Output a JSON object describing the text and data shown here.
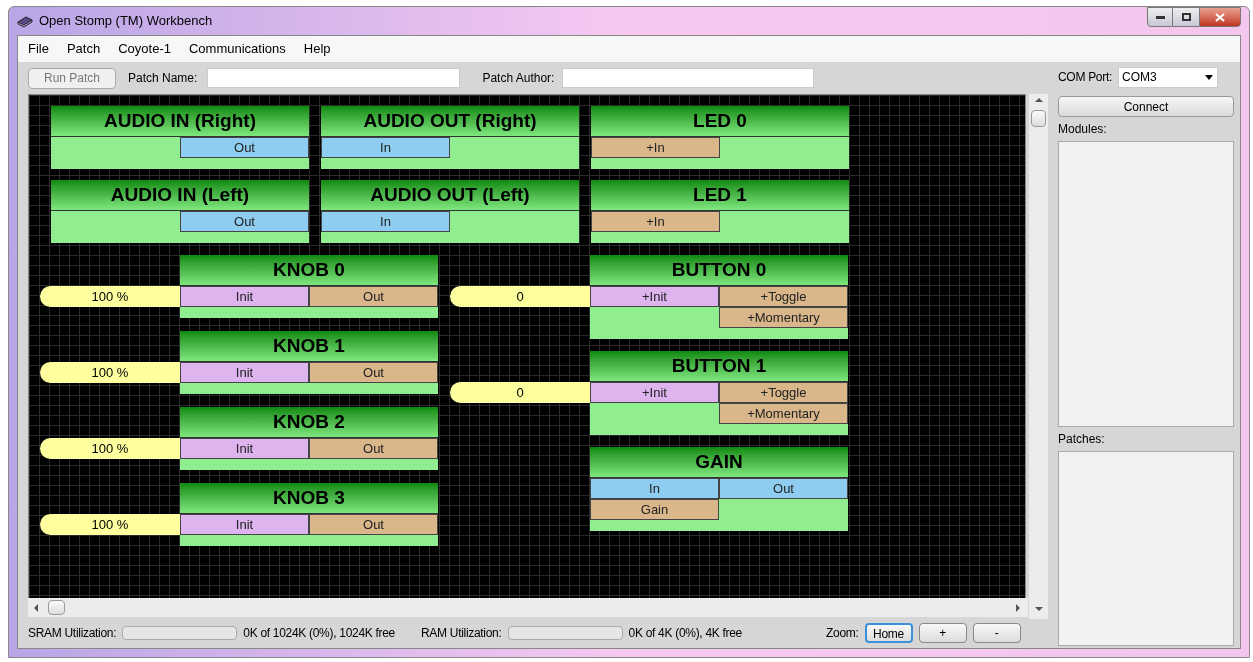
{
  "window": {
    "title": "Open Stomp (TM) Workbench"
  },
  "menu": [
    "File",
    "Patch",
    "Coyote-1",
    "Communications",
    "Help"
  ],
  "toolbar": {
    "run_button": {
      "label": "Run Patch",
      "disabled": true
    },
    "patch_name": {
      "label": "Patch Name:"
    },
    "patch_author": {
      "label": "Patch Author:"
    }
  },
  "canvas": {
    "top_columns": [
      [
        {
          "title": "AUDIO IN (Right)",
          "rows": [
            [
              "",
              {
                "label": "Out",
                "kind": "audio"
              }
            ]
          ]
        },
        {
          "title": "AUDIO IN (Left)",
          "rows": [
            [
              "",
              {
                "label": "Out",
                "kind": "audio"
              }
            ]
          ]
        }
      ],
      [
        {
          "title": "AUDIO OUT (Right)",
          "rows": [
            [
              {
                "label": "In",
                "kind": "audio"
              },
              ""
            ]
          ]
        },
        {
          "title": "AUDIO OUT (Left)",
          "rows": [
            [
              {
                "label": "In",
                "kind": "audio"
              },
              ""
            ]
          ]
        }
      ],
      [
        {
          "title": "LED 0",
          "rows": [
            [
              {
                "label": "+In",
                "kind": "control"
              },
              ""
            ]
          ]
        },
        {
          "title": "LED 1",
          "rows": [
            [
              {
                "label": "+In",
                "kind": "control"
              },
              ""
            ]
          ]
        }
      ]
    ],
    "left_modules": [
      {
        "title": "KNOB 0",
        "value": "100 %",
        "rows": [
          [
            {
              "label": "Init",
              "kind": "init"
            },
            {
              "label": "Out",
              "kind": "control"
            }
          ]
        ]
      },
      {
        "title": "KNOB 1",
        "value": "100 %",
        "rows": [
          [
            {
              "label": "Init",
              "kind": "init"
            },
            {
              "label": "Out",
              "kind": "control"
            }
          ]
        ]
      },
      {
        "title": "KNOB 2",
        "value": "100 %",
        "rows": [
          [
            {
              "label": "Init",
              "kind": "init"
            },
            {
              "label": "Out",
              "kind": "control"
            }
          ]
        ]
      },
      {
        "title": "KNOB 3",
        "value": "100 %",
        "rows": [
          [
            {
              "label": "Init",
              "kind": "init"
            },
            {
              "label": "Out",
              "kind": "control"
            }
          ]
        ]
      }
    ],
    "right_modules": [
      {
        "title": "BUTTON 0",
        "value": "0",
        "rows": [
          [
            {
              "label": "+Init",
              "kind": "init"
            },
            {
              "label": "+Toggle",
              "kind": "control"
            }
          ],
          [
            "",
            {
              "label": "+Momentary",
              "kind": "control"
            }
          ]
        ]
      },
      {
        "title": "BUTTON 1",
        "value": "0",
        "rows": [
          [
            {
              "label": "+Init",
              "kind": "init"
            },
            {
              "label": "+Toggle",
              "kind": "control"
            }
          ],
          [
            "",
            {
              "label": "+Momentary",
              "kind": "control"
            }
          ]
        ]
      },
      {
        "title": "GAIN",
        "rows": [
          [
            {
              "label": "In",
              "kind": "audio"
            },
            {
              "label": "Out",
              "kind": "audio"
            }
          ],
          [
            {
              "label": "Gain",
              "kind": "control"
            },
            ""
          ]
        ]
      }
    ]
  },
  "status_bar": {
    "meters": [
      {
        "label": "SRAM Utilization:",
        "reading": "0K of 1024K (0%), 1024K free"
      },
      {
        "label": "RAM Utilization:",
        "reading": "0K of 4K (0%), 4K free"
      }
    ],
    "zoom": {
      "label": "Zoom:",
      "buttons": [
        {
          "label": "Home",
          "selected": true
        },
        {
          "label": "+",
          "selected": false
        },
        {
          "label": "-",
          "selected": false
        }
      ]
    }
  },
  "side_panel": {
    "com_port": {
      "label": "COM Port:",
      "value": "COM3"
    },
    "connect_button": "Connect",
    "lists": [
      {
        "label": "Modules:"
      },
      {
        "label": "Patches:"
      }
    ]
  }
}
